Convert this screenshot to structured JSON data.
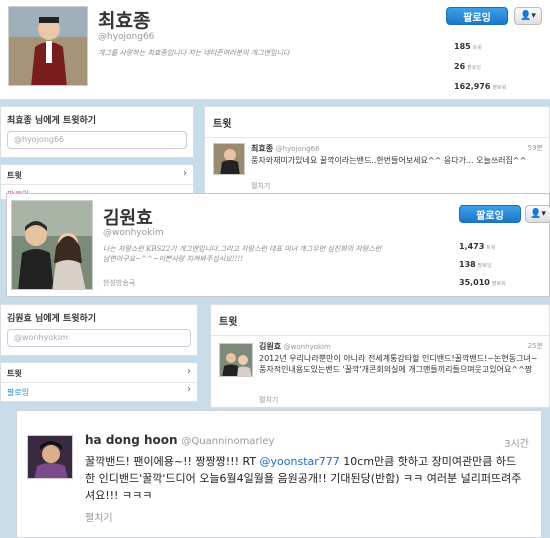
{
  "p1": {
    "name": "최효종",
    "handle": "@hyojong66",
    "bio": "개그를 사랑하는 최효종입니다 저는 네티즌여러분의 개그맨입니다",
    "follow_label": "팔로잉",
    "user_menu_label": "▾",
    "stats": [
      {
        "num": "185",
        "lbl": "트윗"
      },
      {
        "num": "26",
        "lbl": "팔로잉"
      },
      {
        "num": "162,976",
        "lbl": "팔로워"
      }
    ],
    "tweet_to_title": "최효종 님에게 트윗하기",
    "tweet_to_placeholder": "@hyojong66",
    "nav_tweets": "트윗",
    "nav_following": "팔로잉",
    "tweets_header": "트윗",
    "tweet": {
      "name": "최효종",
      "handle": "@hyojong66",
      "time": "59분",
      "text": "풍자와재미가있네요 꿀깍이라는밴드..한번들어보세요^^ 응다가... 오늘쓰러집^^",
      "expand": "펼치기"
    }
  },
  "p2": {
    "name": "김원효",
    "handle": "@wonhyokim",
    "bio": "나는 자랑스런 KBS22기 개그맨입니다.그리고 자랑스런 대표 미녀 개그우먼 심진화의 자랑스런 남편이구요~^^~이쁜사랑 지켜봐주십시요!!!!",
    "location": "한성방송국",
    "follow_label": "팔로잉",
    "user_menu_label": "▾",
    "stats": [
      {
        "num": "1,473",
        "lbl": "트윗"
      },
      {
        "num": "138",
        "lbl": "팔로잉"
      },
      {
        "num": "35,010",
        "lbl": "팔로워"
      }
    ],
    "tweet_to_title": "김원효 님에게 트윗하기",
    "tweet_to_placeholder": "@wonhyokim",
    "nav_tweets": "트윗",
    "nav_following": "팔로잉",
    "tweets_header": "트윗",
    "tweet": {
      "name": "김원효",
      "handle": "@wonhyokim",
      "time": "25분",
      "text": "2012년 우리나라뿐만이 아니라 전세계통강타할 인디밴드!꿀깍밴드!~논현동그녀~ 풍자적인내용도있는밴드 '꿀깍'개콘회의실에 개그맨들끼리들으며웃고있어요^^짱",
      "expand": "펼치기"
    }
  },
  "p3": {
    "name": "ha dong hoon",
    "handle": "@Quanninomarley",
    "time": "3시간",
    "text_pre": "꿀깍밴드! 팬이에용~!! 짱짱짱!!! RT ",
    "text_mention": "@yoonstar777",
    "text_post": " 10cm만큼 핫하고 장미여관만큼 하드한 인디밴드'꿀깍'드디어 오늘6월4일월욜 음원공개!! 기대된당(반함) ㅋㅋ 여러분 널리퍼뜨려주셔요!!! ㅋㅋㅋ",
    "expand": "펼치기"
  },
  "colors": {
    "accent": "#2a88d8",
    "mention": "#1d70c0"
  }
}
